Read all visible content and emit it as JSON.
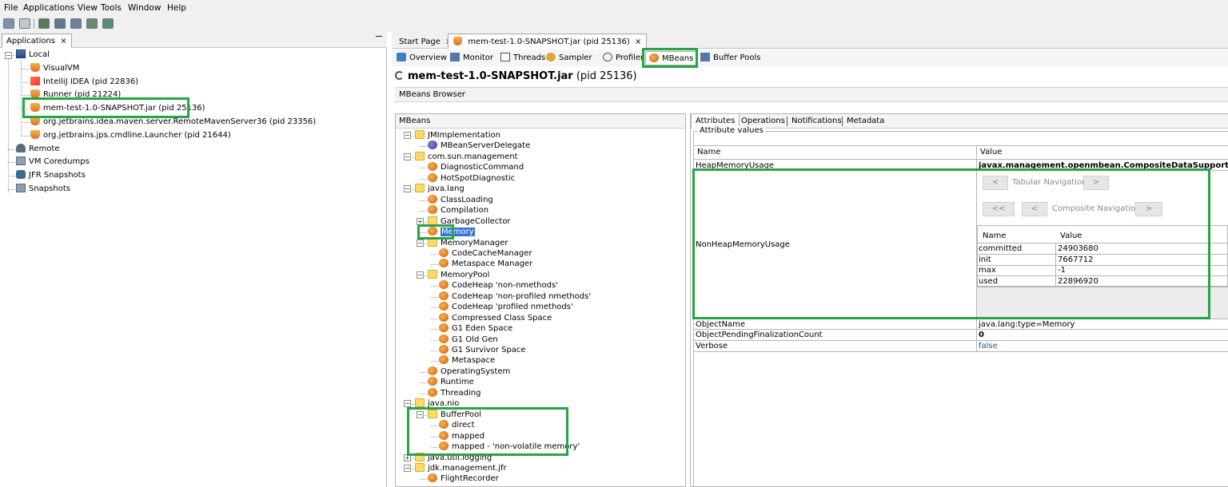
{
  "menu": {
    "file": "File",
    "applications": "Applications",
    "view": "View",
    "tools": "Tools",
    "window": "Window",
    "help": "Help"
  },
  "toolbar": {
    "icons": [
      "open-snapshot-icon",
      "save-icon",
      "add-jmx-connection-icon",
      "add-remote-host-icon",
      "add-core-dump-icon",
      "compare-snapshots-icon"
    ]
  },
  "left": {
    "tab_label": "Applications",
    "close_glyph": "×",
    "tree": {
      "local": "Local",
      "apps": [
        {
          "label": "VisualVM",
          "icon": "visualvm-icon"
        },
        {
          "label": "IntelliJ IDEA (pid 22836)",
          "icon": "intellij-icon"
        },
        {
          "label": "Runner (pid 21224)",
          "icon": "java-icon"
        },
        {
          "label": "mem-test-1.0-SNAPSHOT.jar (pid 25136)",
          "icon": "java-icon"
        },
        {
          "label": "org.jetbrains.idea.maven.server.RemoteMavenServer36 (pid 23356)",
          "icon": "java-icon"
        },
        {
          "label": "org.jetbrains.jps.cmdline.Launcher (pid 21644)",
          "icon": "java-icon"
        }
      ],
      "remote": "Remote",
      "coredumps": "VM Coredumps",
      "jfr": "JFR Snapshots",
      "snapshots": "Snapshots"
    }
  },
  "tabs": {
    "start_page": "Start Page",
    "app_tab": "mem-test-1.0-SNAPSHOT.jar (pid 25136)",
    "close_glyph": "×"
  },
  "subtabs": [
    "Overview",
    "Monitor",
    "Threads",
    "Sampler",
    "Profiler",
    "MBeans",
    "Buffer Pools"
  ],
  "app": {
    "title_bold": "mem-test-1.0-SNAPSHOT.jar",
    "title_pid": "(pid 25136)",
    "browser_label": "MBeans Browser"
  },
  "mbeans": {
    "header": "MBeans",
    "tree": [
      {
        "label": "JMImplementation",
        "kind": "folder",
        "level": 0
      },
      {
        "label": "MBeanServerDelegate",
        "kind": "bean-b",
        "level": 1
      },
      {
        "label": "com.sun.management",
        "kind": "folder",
        "level": 0
      },
      {
        "label": "DiagnosticCommand",
        "kind": "bean",
        "level": 1
      },
      {
        "label": "HotSpotDiagnostic",
        "kind": "bean",
        "level": 1
      },
      {
        "label": "java.lang",
        "kind": "folder",
        "level": 0
      },
      {
        "label": "ClassLoading",
        "kind": "bean",
        "level": 1
      },
      {
        "label": "Compilation",
        "kind": "bean",
        "level": 1
      },
      {
        "label": "GarbageCollector",
        "kind": "folder",
        "level": 1
      },
      {
        "label": "Memory",
        "kind": "bean",
        "level": 1
      },
      {
        "label": "MemoryManager",
        "kind": "folder",
        "level": 1
      },
      {
        "label": "CodeCacheManager",
        "kind": "bean",
        "level": 2
      },
      {
        "label": "Metaspace Manager",
        "kind": "bean",
        "level": 2
      },
      {
        "label": "MemoryPool",
        "kind": "folder",
        "level": 1
      },
      {
        "label": "CodeHeap 'non-nmethods'",
        "kind": "bean",
        "level": 2
      },
      {
        "label": "CodeHeap 'non-profiled nmethods'",
        "kind": "bean",
        "level": 2
      },
      {
        "label": "CodeHeap 'profiled nmethods'",
        "kind": "bean",
        "level": 2
      },
      {
        "label": "Compressed Class Space",
        "kind": "bean",
        "level": 2
      },
      {
        "label": "G1 Eden Space",
        "kind": "bean",
        "level": 2
      },
      {
        "label": "G1 Old Gen",
        "kind": "bean",
        "level": 2
      },
      {
        "label": "G1 Survivor Space",
        "kind": "bean",
        "level": 2
      },
      {
        "label": "Metaspace",
        "kind": "bean",
        "level": 2
      },
      {
        "label": "OperatingSystem",
        "kind": "bean",
        "level": 1
      },
      {
        "label": "Runtime",
        "kind": "bean",
        "level": 1
      },
      {
        "label": "Threading",
        "kind": "bean",
        "level": 1
      },
      {
        "label": "java.nio",
        "kind": "folder",
        "level": 0
      },
      {
        "label": "BufferPool",
        "kind": "folder",
        "level": 1
      },
      {
        "label": "direct",
        "kind": "bean",
        "level": 2
      },
      {
        "label": "mapped",
        "kind": "bean",
        "level": 2
      },
      {
        "label": "mapped - 'non-volatile memory'",
        "kind": "bean",
        "level": 2
      },
      {
        "label": "java.util.logging",
        "kind": "folder",
        "level": 0
      },
      {
        "label": "jdk.management.jfr",
        "kind": "folder",
        "level": 0
      },
      {
        "label": "FlightRecorder",
        "kind": "bean",
        "level": 1
      }
    ]
  },
  "attributes": {
    "tabs": [
      "Attributes",
      "Operations",
      "Notifications",
      "Metadata"
    ],
    "legend": "Attribute values",
    "col_name": "Name",
    "col_value": "Value",
    "rows": {
      "heap_name": "HeapMemoryUsage",
      "heap_value": "javax.management.openmbean.CompositeDataSupport",
      "nonheap_name": "NonHeapMemoryUsage",
      "objectname_name": "ObjectName",
      "objectname_value": "java.lang:type=Memory",
      "pending_name": "ObjectPendingFinalizationCount",
      "pending_value": "0",
      "verbose_name": "Verbose",
      "verbose_value": "false"
    },
    "nav": {
      "prev": "<",
      "next": ">",
      "first": "<<",
      "tabular": "Tabular Navigation",
      "composite": "Composite Navigation"
    },
    "composite": {
      "col_name": "Name",
      "col_value": "Value",
      "rows": [
        {
          "name": "committed",
          "value": "24903680"
        },
        {
          "name": "init",
          "value": "7667712"
        },
        {
          "name": "max",
          "value": "-1"
        },
        {
          "name": "used",
          "value": "22896920"
        }
      ]
    }
  },
  "colors": {
    "highlight_box": "#27a444",
    "selection": "#3874d8",
    "link_value": "#1d4fa3"
  }
}
